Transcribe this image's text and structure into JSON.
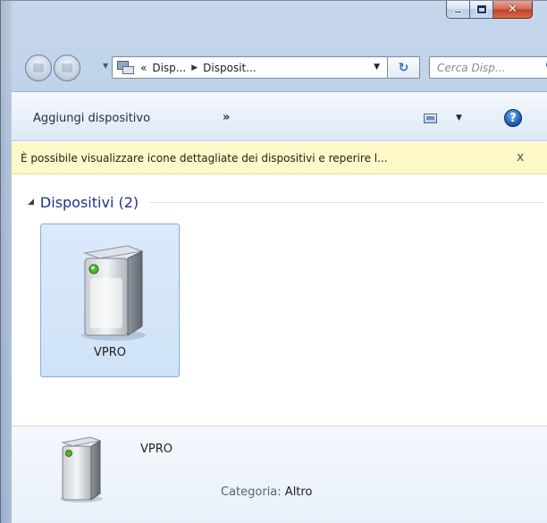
{
  "window": {
    "caption_buttons": [
      "minimize",
      "maximize",
      "close"
    ]
  },
  "address": {
    "breadcrumb_prefix": "«",
    "crumbs": [
      "Disp...",
      "Disposit..."
    ],
    "search_placeholder": "Cerca Disp..."
  },
  "toolbar": {
    "add_device_label": "Aggiungi dispositivo",
    "more_label": "»",
    "help_label": "?"
  },
  "infobar": {
    "text": "È possibile visualizzare icone dettagliate dei dispositivi e reperire l...",
    "close_label": "x"
  },
  "group": {
    "title": "Dispositivi (2)"
  },
  "devices": [
    {
      "name": "VPRO",
      "icon": "storage-device-icon",
      "selected": true
    }
  ],
  "details": {
    "name": "VPRO",
    "category_label": "Categoria:",
    "category_value": "Altro"
  },
  "colors": {
    "accent_blue": "#1e3287",
    "selection_bg": "#cfe2f8",
    "infobar_bg": "#fff8c8",
    "status_led": "#6fd23c"
  }
}
